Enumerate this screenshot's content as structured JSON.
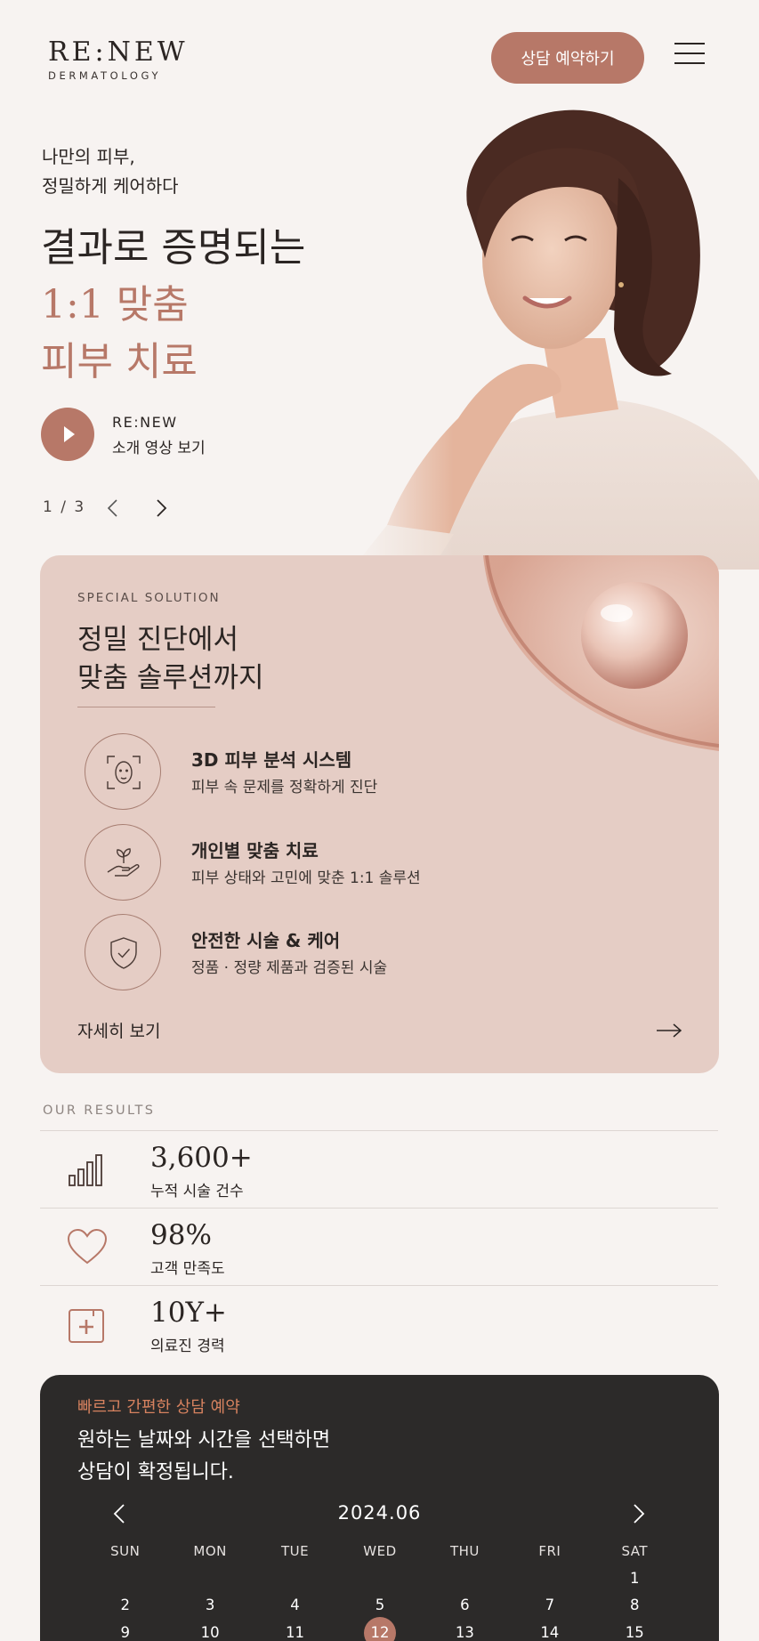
{
  "header": {
    "logo_main": "RE:NEW",
    "logo_sub": "DERMATOLOGY",
    "book_button": "상담 예약하기"
  },
  "hero": {
    "kicker_line1": "나만의 피부,",
    "kicker_line2": "정밀하게 케어하다",
    "title_line1": "결과로 증명되는",
    "title_line2": "1:1 맞춤",
    "title_line3": "피부 치료",
    "video_brand": "RE:NEW",
    "video_label": "소개 영상 보기",
    "pager": "1 / 3"
  },
  "solution": {
    "kicker": "SPECIAL SOLUTION",
    "title_line1": "정밀 진단에서",
    "title_line2": "맞춤 솔루션까지",
    "features": [
      {
        "icon": "face-scan-icon",
        "title": "3D 피부 분석 시스템",
        "desc": "피부 속 문제를 정확하게 진단"
      },
      {
        "icon": "hand-sprout-icon",
        "title": "개인별 맞춤 치료",
        "desc": "피부 상태와 고민에 맞춘 1:1 솔루션"
      },
      {
        "icon": "shield-check-icon",
        "title": "안전한 시술 & 케어",
        "desc": "정품 · 정량 제품과 검증된 시술"
      }
    ],
    "more_label": "자세히 보기"
  },
  "results": {
    "kicker": "OUR RESULTS",
    "items": [
      {
        "icon": "bar-chart-icon",
        "value": "3,600+",
        "label": "누적 시술 건수"
      },
      {
        "icon": "heart-icon",
        "value": "98%",
        "label": "고객 만족도"
      },
      {
        "icon": "medical-kit-icon",
        "value": "10Y+",
        "label": "의료진 경력"
      }
    ]
  },
  "booking": {
    "kicker": "빠르고 간편한 상담 예약",
    "title_line1": "원하는 날짜와 시간을 선택하면",
    "title_line2": "상담이 확정됩니다.",
    "month": "2024.06",
    "weekdays": [
      "SUN",
      "MON",
      "TUE",
      "WED",
      "THU",
      "FRI",
      "SAT"
    ],
    "weeks": [
      [
        "",
        "",
        "",
        "",
        "",
        "",
        "1"
      ],
      [
        "2",
        "3",
        "4",
        "5",
        "6",
        "7",
        "8"
      ],
      [
        "9",
        "10",
        "11",
        "12",
        "13",
        "14",
        "15"
      ]
    ],
    "selected_day": "12"
  },
  "colors": {
    "accent": "#b77868",
    "card_bg": "#e5cdc5",
    "booking_bg": "#2c2a29",
    "booking_kicker": "#d7825f",
    "page_bg": "#f7f3f1"
  }
}
